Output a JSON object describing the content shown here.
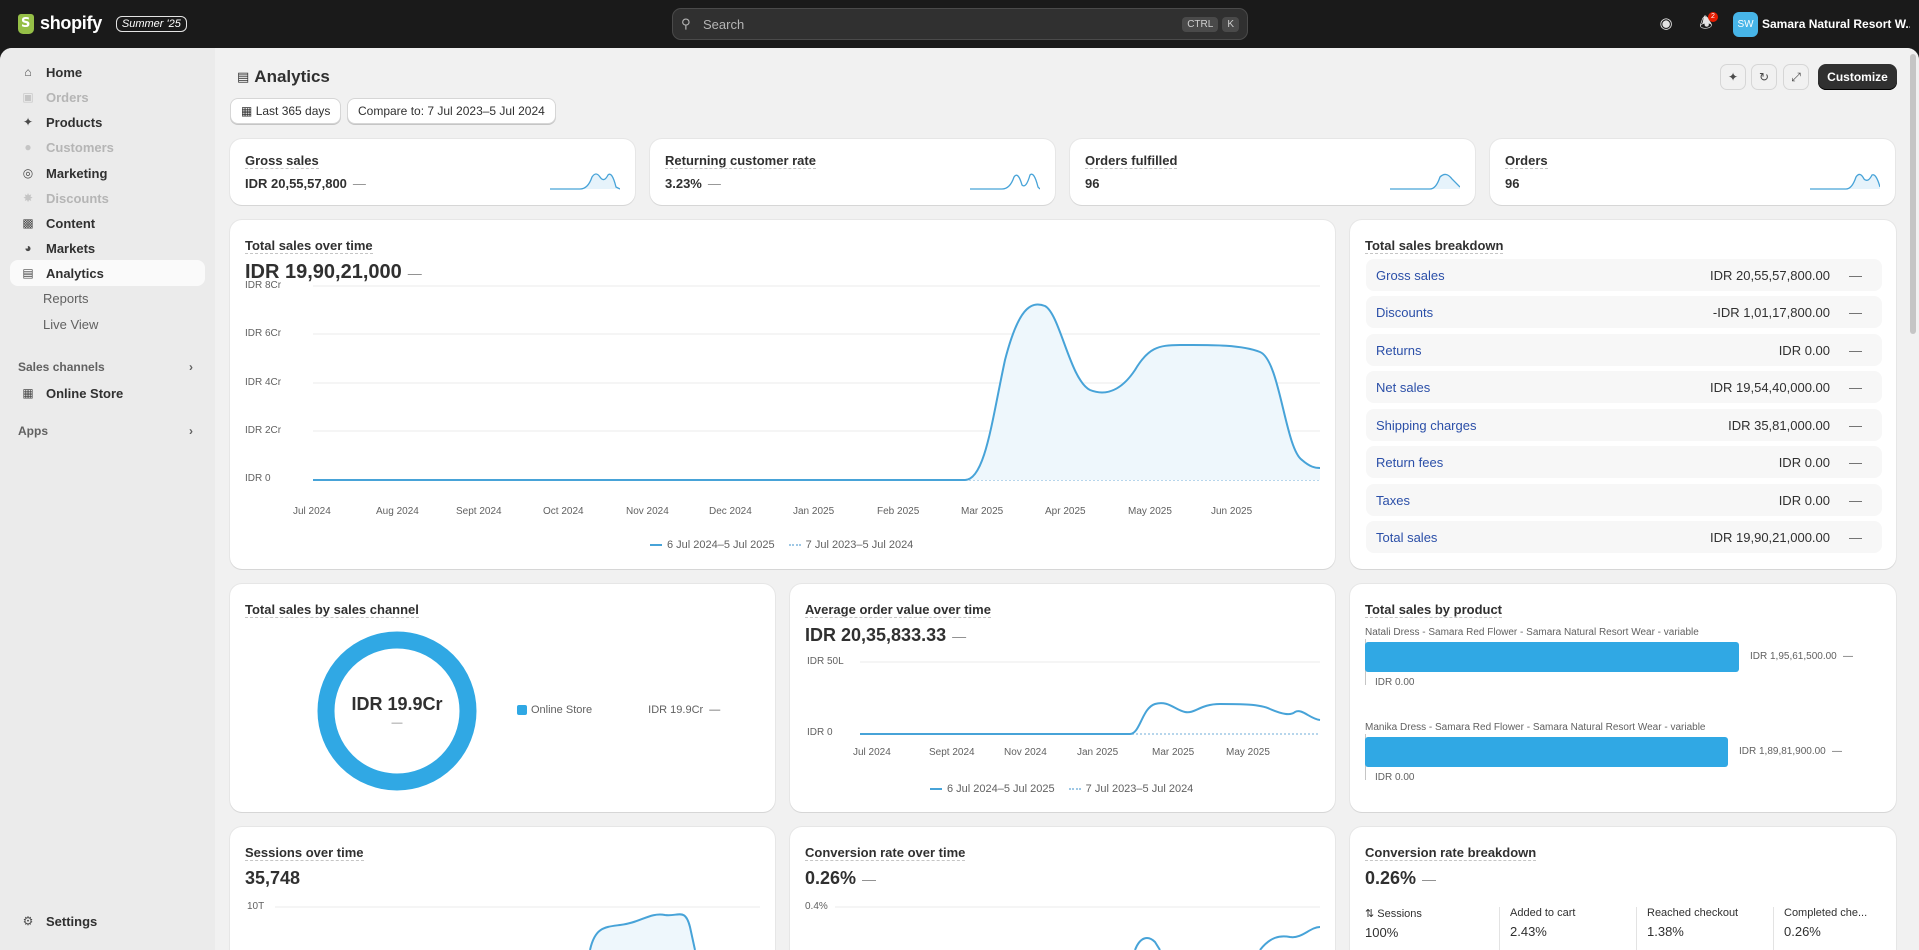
{
  "topbar": {
    "logo_text": "shopify",
    "edition": "Summer '25",
    "search_placeholder": "Search",
    "kbd_ctrl": "CTRL",
    "kbd_k": "K",
    "notification_count": "2",
    "avatar_initials": "SW",
    "store_name": "Samara Natural Resort W..."
  },
  "sidebar": {
    "items": [
      {
        "label": "Home",
        "icon": "home-icon"
      },
      {
        "label": "Orders",
        "icon": "orders-icon"
      },
      {
        "label": "Products",
        "icon": "tag-icon"
      },
      {
        "label": "Customers",
        "icon": "person-icon"
      },
      {
        "label": "Marketing",
        "icon": "target-icon"
      },
      {
        "label": "Discounts",
        "icon": "discount-icon"
      },
      {
        "label": "Content",
        "icon": "image-icon"
      },
      {
        "label": "Markets",
        "icon": "globe-icon"
      },
      {
        "label": "Analytics",
        "icon": "chart-icon"
      },
      {
        "label": "Reports"
      },
      {
        "label": "Live View"
      }
    ],
    "sales_channels_label": "Sales channels",
    "online_store_label": "Online Store",
    "apps_label": "Apps",
    "settings_label": "Settings"
  },
  "page": {
    "title": "Analytics",
    "date_filter": "Last 365 days",
    "compare_filter": "Compare to: 7 Jul 2023–5 Jul 2024",
    "customize_label": "Customize"
  },
  "metrics": [
    {
      "title": "Gross sales",
      "value": "IDR 20,55,57,800",
      "dash": "—"
    },
    {
      "title": "Returning customer rate",
      "value": "3.23%",
      "dash": "—"
    },
    {
      "title": "Orders fulfilled",
      "value": "96",
      "dash": ""
    },
    {
      "title": "Orders",
      "value": "96",
      "dash": ""
    }
  ],
  "total_sales_chart": {
    "title": "Total sales over time",
    "value": "IDR 19,90,21,000",
    "dash": "—",
    "y_ticks": [
      "IDR 8Cr",
      "IDR 6Cr",
      "IDR 4Cr",
      "IDR 2Cr",
      "IDR 0"
    ],
    "x_ticks": [
      "Jul 2024",
      "Aug 2024",
      "Sept 2024",
      "Oct 2024",
      "Nov 2024",
      "Dec 2024",
      "Jan 2025",
      "Feb 2025",
      "Mar 2025",
      "Apr 2025",
      "May 2025",
      "Jun 2025"
    ],
    "legend_current": "6 Jul 2024–5 Jul 2025",
    "legend_previous": "7 Jul 2023–5 Jul 2024"
  },
  "breakdown": {
    "title": "Total sales breakdown",
    "rows": [
      {
        "label": "Gross sales",
        "value": "IDR 20,55,57,800.00",
        "dash": "—"
      },
      {
        "label": "Discounts",
        "value": "-IDR 1,01,17,800.00",
        "dash": "—"
      },
      {
        "label": "Returns",
        "value": "IDR 0.00",
        "dash": "—"
      },
      {
        "label": "Net sales",
        "value": "IDR 19,54,40,000.00",
        "dash": "—"
      },
      {
        "label": "Shipping charges",
        "value": "IDR 35,81,000.00",
        "dash": "—"
      },
      {
        "label": "Return fees",
        "value": "IDR 0.00",
        "dash": "—"
      },
      {
        "label": "Taxes",
        "value": "IDR 0.00",
        "dash": "—"
      },
      {
        "label": "Total sales",
        "value": "IDR 19,90,21,000.00",
        "dash": "—"
      }
    ]
  },
  "channel_chart": {
    "title": "Total sales by sales channel",
    "center_value": "IDR 19.9Cr",
    "center_dash": "—",
    "legend_name": "Online Store",
    "legend_value": "IDR 19.9Cr",
    "legend_dash": "—",
    "color": "#30a8e4"
  },
  "aov_chart": {
    "title": "Average order value over time",
    "value": "IDR 20,35,833.33",
    "dash": "—",
    "y_ticks": [
      "IDR 50L",
      "IDR 0"
    ],
    "x_ticks": [
      "Jul 2024",
      "Sept 2024",
      "Nov 2024",
      "Jan 2025",
      "Mar 2025",
      "May 2025"
    ],
    "legend_current": "6 Jul 2024–5 Jul 2025",
    "legend_previous": "7 Jul 2023–5 Jul 2024"
  },
  "product_chart": {
    "title": "Total sales by product",
    "products": [
      {
        "name": "Natali Dress - Samara Red Flower - Samara Natural Resort Wear - variable",
        "value": "IDR 1,95,61,500.00",
        "prev": "IDR 0.00",
        "dash": "—",
        "share": 1.0
      },
      {
        "name": "Manika Dress - Samara Red Flower - Samara Natural Resort Wear - variable",
        "value": "IDR 1,89,81,900.00",
        "prev": "IDR 0.00",
        "dash": "—",
        "share": 0.97
      }
    ]
  },
  "sessions_chart": {
    "title": "Sessions over time",
    "value": "35,748",
    "y_tick": "10T"
  },
  "conversion_chart": {
    "title": "Conversion rate over time",
    "value": "0.26%",
    "dash": "—",
    "y_tick": "0.4%"
  },
  "conversion_breakdown": {
    "title": "Conversion rate breakdown",
    "value": "0.26%",
    "dash": "—",
    "steps": [
      {
        "name": "Sessions",
        "value": "100%"
      },
      {
        "name": "Added to cart",
        "value": "2.43%"
      },
      {
        "name": "Reached checkout",
        "value": "1.38%"
      },
      {
        "name": "Completed che...",
        "value": "0.26%"
      }
    ]
  }
}
